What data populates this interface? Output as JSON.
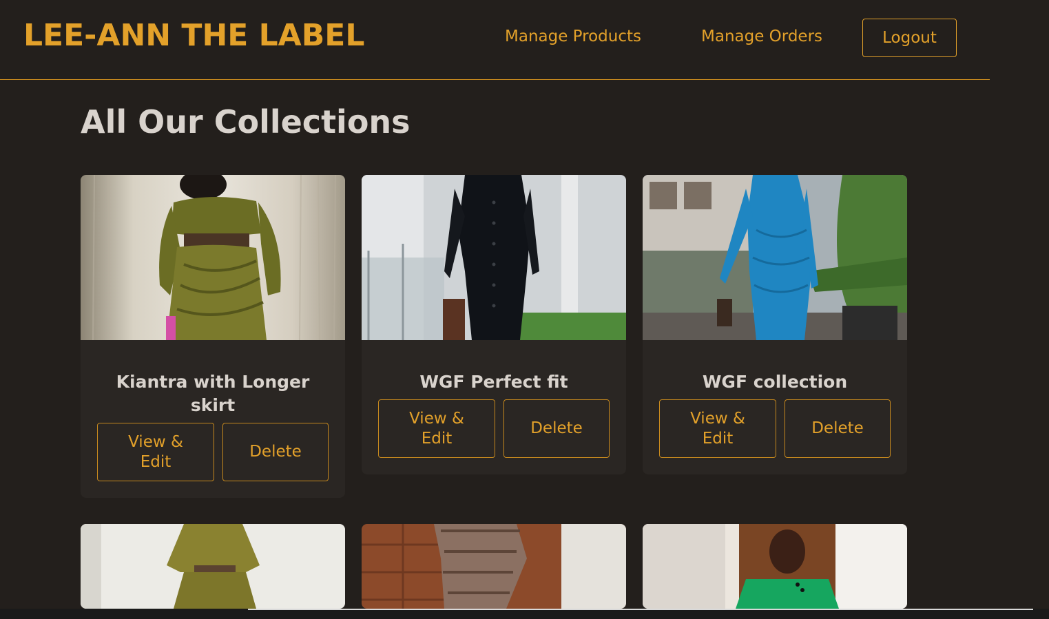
{
  "header": {
    "brand": "LEE-ANN THE LABEL",
    "nav": {
      "manage_products": "Manage Products",
      "manage_orders": "Manage Orders",
      "logout": "Logout"
    }
  },
  "main": {
    "title": "All Our Collections",
    "products": [
      {
        "name": "Kiantra with Longer skirt",
        "edit_label": "View & Edit",
        "delete_label": "Delete",
        "image_icon": "olive-two-piece-photo"
      },
      {
        "name": "WGF Perfect fit",
        "edit_label": "View & Edit",
        "delete_label": "Delete",
        "image_icon": "black-dress-photo"
      },
      {
        "name": "WGF collection",
        "edit_label": "View & Edit",
        "delete_label": "Delete",
        "image_icon": "blue-dress-photo"
      }
    ],
    "more_products": [
      {
        "image_icon": "olive-print-set-photo"
      },
      {
        "image_icon": "snakeskin-dress-photo"
      },
      {
        "image_icon": "green-top-photo"
      }
    ]
  },
  "colors": {
    "background": "#231f1c",
    "card": "#2a2623",
    "accent": "#e3a12a",
    "text": "#d9d3cd"
  }
}
